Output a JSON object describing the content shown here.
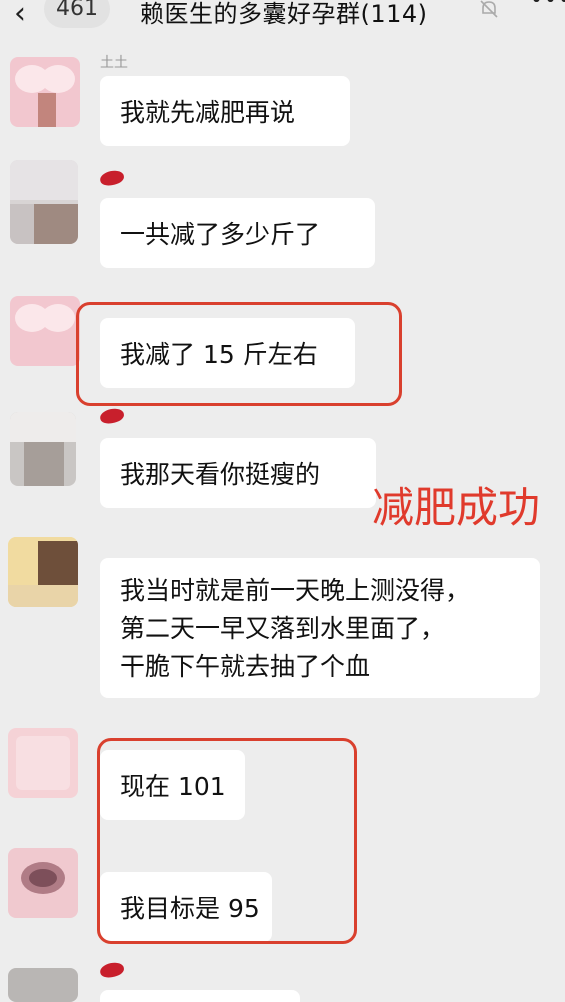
{
  "header": {
    "back_icon": "chevron-left-icon",
    "unread_count": "461",
    "title": "赖医生的多囊好孕群(114)",
    "mute_icon": "bell-off-icon",
    "more_icon": "more-icon"
  },
  "messages": [
    {
      "sender": "土土",
      "text": "我就先减肥再说"
    },
    {
      "sender": "",
      "text": "一共减了多少斤了"
    },
    {
      "sender": "",
      "text": "我减了 15 斤左右"
    },
    {
      "sender": "",
      "text": "我那天看你挺瘦的"
    },
    {
      "sender": "",
      "lines": [
        "我当时就是前一天晚上测没得，",
        "第二天一早又落到水里面了，",
        "干脆下午就去抽了个血"
      ]
    },
    {
      "sender": "",
      "text": "现在 101"
    },
    {
      "sender": "",
      "text": "我目标是 95"
    },
    {
      "sender": "",
      "text": ""
    }
  ],
  "annotation": "减肥成功",
  "colors": {
    "highlight": "#d9402e",
    "annotation": "#e03a2c",
    "background": "#ededed",
    "bubble": "#ffffff"
  }
}
